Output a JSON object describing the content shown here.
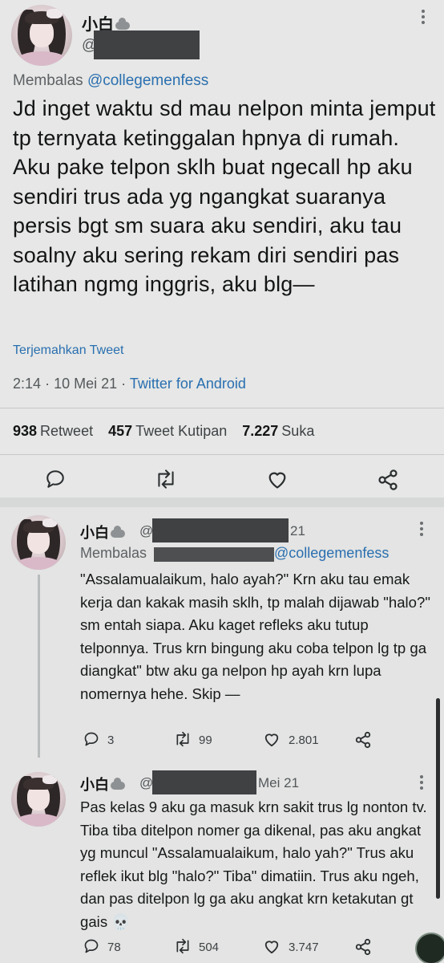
{
  "main_tweet": {
    "display_name": "小白",
    "handle_prefix": "@",
    "replying_prefix": "Membalas",
    "replying_to": "@collegemenfess",
    "text": "Jd inget waktu sd mau nelpon minta jemput tp ternyata ketinggalan hpnya di rumah. Aku pake telpon sklh buat ngecall hp aku sendiri trus ada yg ngangkat suaranya persis bgt sm suara aku sendiri, aku tau soalny aku sering rekam diri sendiri pas latihan ngmg inggris, aku blg—",
    "translate_label": "Terjemahkan Tweet",
    "time": "2:14",
    "date": "10 Mei 21",
    "source": "Twitter for Android",
    "retweets": "938",
    "retweets_label": "Retweet",
    "quotes": "457",
    "quotes_label": "Tweet Kutipan",
    "likes": "7.227",
    "likes_label": "Suka"
  },
  "replies": [
    {
      "display_name": "小白",
      "handle_prefix": "@",
      "date_suffix": "21",
      "replying_prefix": "Membalas",
      "replying_to": "@collegemenfess",
      "text": "\"Assalamualaikum, halo ayah?\" Krn aku tau emak kerja dan kakak masih sklh, tp malah dijawab \"halo?\" sm entah siapa. Aku kaget refleks aku tutup telponnya. Trus krn bingung aku coba telpon lg tp ga diangkat\" btw aku ga nelpon hp ayah krn lupa nomernya hehe. Skip —",
      "replies": "3",
      "retweets": "99",
      "likes": "2.801"
    },
    {
      "display_name": "小白",
      "handle_prefix": "@",
      "date_suffix": "Mei 21",
      "text": "Pas kelas 9 aku ga masuk krn sakit trus lg nonton tv. Tiba tiba ditelpon nomer ga dikenal, pas aku angkat yg muncul \"Assalamualaikum, halo yah?\" Trus aku reflek ikut blg \"halo?\" Tiba\" dimatiin. Trus aku ngeh, dan pas ditelpon lg ga aku angkat krn ketakutan gt gais 💀",
      "replies": "78",
      "retweets": "504",
      "likes": "3.747"
    }
  ],
  "icons": {
    "status": "cloud-icon",
    "more": "more-vertical-icon",
    "reply": "reply-icon",
    "retweet": "retweet-icon",
    "like": "heart-icon",
    "share": "share-icon"
  },
  "colors": {
    "link": "#2a6fb0",
    "text": "#141516",
    "muted": "#55595c",
    "background": "#e6e7e6"
  }
}
